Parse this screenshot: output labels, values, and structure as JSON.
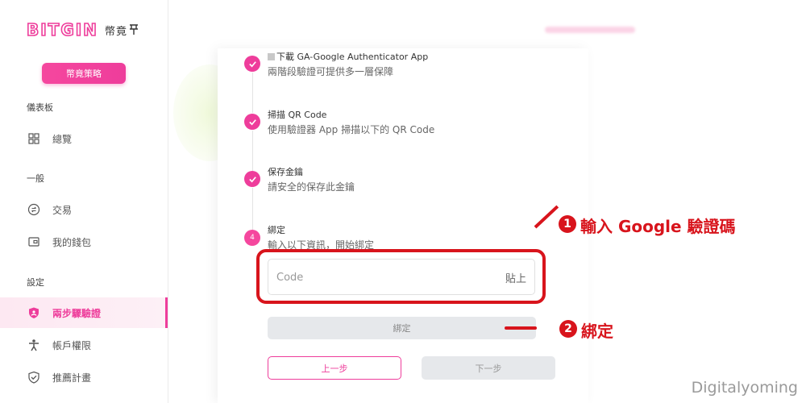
{
  "brand": {
    "logo": "BITGIN",
    "subtitle": "幣竟"
  },
  "sidebar": {
    "strategy_button": "幣竟策略",
    "sections": [
      {
        "title": "儀表板",
        "items": [
          {
            "label": "總覽",
            "icon": "grid-icon"
          }
        ]
      },
      {
        "title": "一般",
        "items": [
          {
            "label": "交易",
            "icon": "exchange-icon"
          },
          {
            "label": "我的錢包",
            "icon": "wallet-icon"
          }
        ]
      },
      {
        "title": "設定",
        "items": [
          {
            "label": "兩步驟驗證",
            "icon": "shield-icon",
            "active": true
          },
          {
            "label": "帳戶權限",
            "icon": "person-icon"
          },
          {
            "label": "推薦計畫",
            "icon": "shield-check-icon"
          }
        ]
      }
    ]
  },
  "steps": [
    {
      "title": "下載 GA-Google Authenticator App",
      "description": "兩階段驗證可提供多一層保障",
      "done": true
    },
    {
      "title": "掃描 QR Code",
      "description": "使用驗證器 App 掃描以下的 QR Code",
      "done": true
    },
    {
      "title": "保存金鑰",
      "description": "請安全的保存此金鑰",
      "done": true
    },
    {
      "number": "4",
      "title": "綁定",
      "description": "輸入以下資訊，開始綁定",
      "done": false
    }
  ],
  "form": {
    "code_placeholder": "Code",
    "paste_label": "貼上",
    "bind_button": "綁定",
    "prev_button": "上一步",
    "next_button": "下一步"
  },
  "annotations": [
    {
      "number": "1",
      "text": "輸入 Google 驗證碼"
    },
    {
      "number": "2",
      "text": "綁定"
    }
  ],
  "watermark": "Digitalyoming",
  "colors": {
    "accent": "#ee3d9b",
    "annotation": "#d8141c"
  }
}
